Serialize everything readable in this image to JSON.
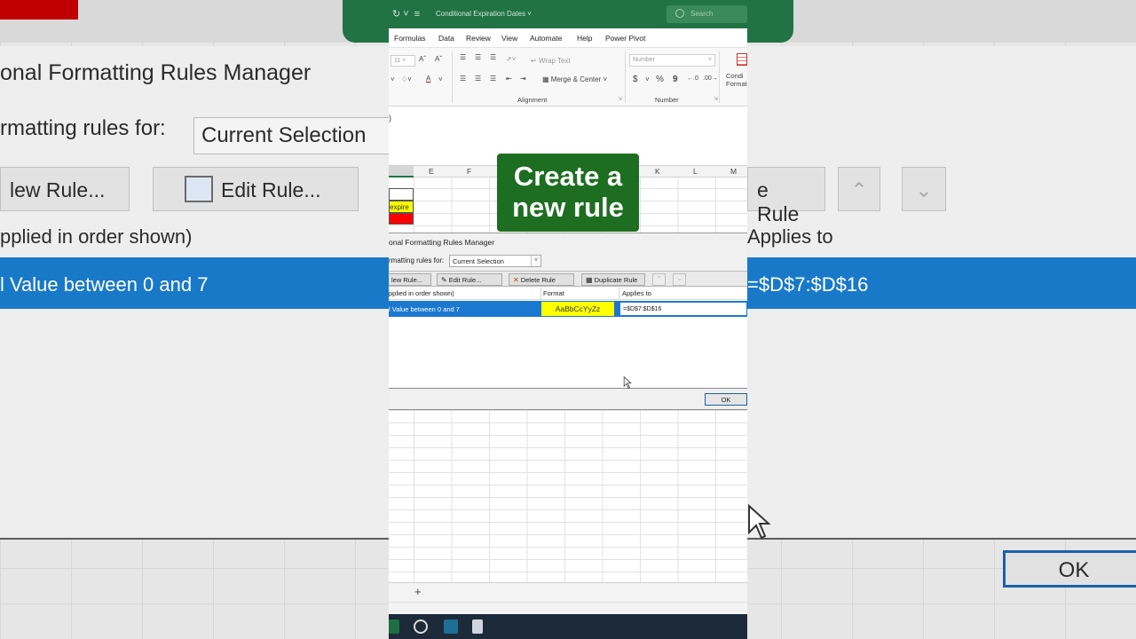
{
  "app": {
    "document_title": "Conditional Expiration Dates",
    "search_placeholder": "Search"
  },
  "menu": [
    "Formulas",
    "Data",
    "Review",
    "View",
    "Automate",
    "Help",
    "Power Pivot"
  ],
  "ribbon": {
    "font_size": "11",
    "wrap_text": "Wrap Text",
    "merge_center": "Merge & Center",
    "number_format": "Number",
    "currency_symbol": "$",
    "percent_symbol": "%",
    "comma_symbol": "9",
    "conditional_formatting": "Condi Format",
    "groups": {
      "alignment": "Alignment",
      "number": "Number"
    }
  },
  "sheet": {
    "columns": [
      "E",
      "F",
      "K",
      "L",
      "M"
    ],
    "cell_expire": "expire"
  },
  "callout": {
    "text": "Create a new rule"
  },
  "dialog": {
    "title": "onal Formatting Rules Manager",
    "show_label": "rmatting rules for:",
    "show_value": "Current Selection",
    "buttons": {
      "new_rule": "lew Rule...",
      "edit_rule": "Edit Rule...",
      "delete_rule": "Delete Rule",
      "duplicate_rule": "Duplicate Rule"
    },
    "columns": {
      "rule": "pplied in order shown)",
      "format": "Format",
      "applies_to": "Applies to"
    },
    "rules": [
      {
        "rule": "l Value between 0 and 7",
        "format_preview": "AaBbCcYyZz",
        "applies_to": "=$D$7:$D$16"
      }
    ],
    "ok": "OK"
  },
  "background": {
    "title": "onal Formatting Rules Manager",
    "show_label": "rmatting rules for:",
    "show_value": "Current Selection",
    "new_rule": "lew Rule...",
    "edit_rule": "Edit Rule...",
    "right_button": "e Rule",
    "col_rule": "pplied in order shown)",
    "col_applies": "Applies to",
    "row_rule": "l Value between 0 and 7",
    "row_applies": "=$D$7:$D$16",
    "ok": "OK"
  },
  "colors": {
    "excel_green": "#217346",
    "callout_green": "#1e6e21",
    "selection_blue": "#1b78d0",
    "format_yellow": "#ffff00",
    "cell_red": "#ff0000"
  }
}
